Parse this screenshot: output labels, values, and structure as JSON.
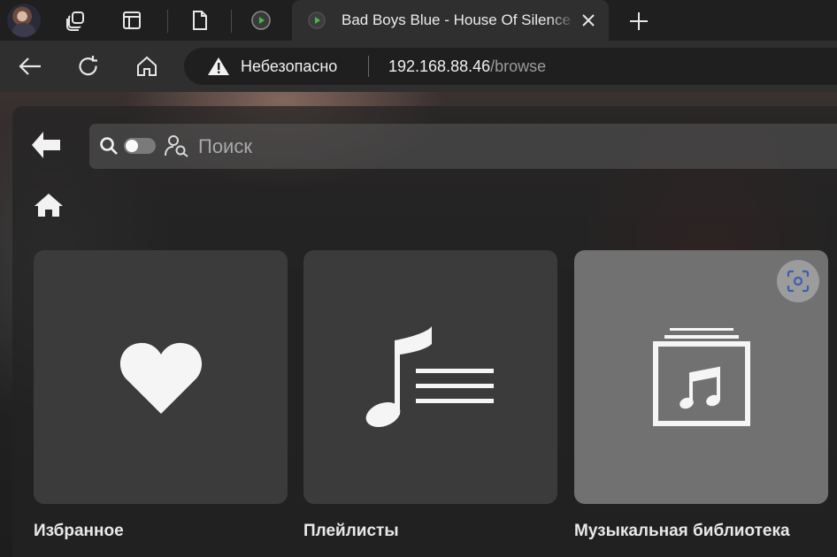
{
  "browser": {
    "tab_title": "Bad Boys Blue - House Of Silence",
    "security_label": "Небезопасно",
    "url_host": "192.168.88.46",
    "url_path": "/browse"
  },
  "page": {
    "search_placeholder": "Поиск",
    "cards": [
      {
        "label": "Избранное",
        "icon": "heart-icon"
      },
      {
        "label": "Плейлисты",
        "icon": "playlist-icon"
      },
      {
        "label": "Музыкальная библиотека",
        "icon": "music-library-icon"
      }
    ]
  },
  "colors": {
    "tab_strip": "#1f1f1f",
    "toolbar": "#2f2f2f",
    "card": "#3b3b3b",
    "card_highlight": "#717171",
    "favicon_accent": "#3fb950"
  }
}
